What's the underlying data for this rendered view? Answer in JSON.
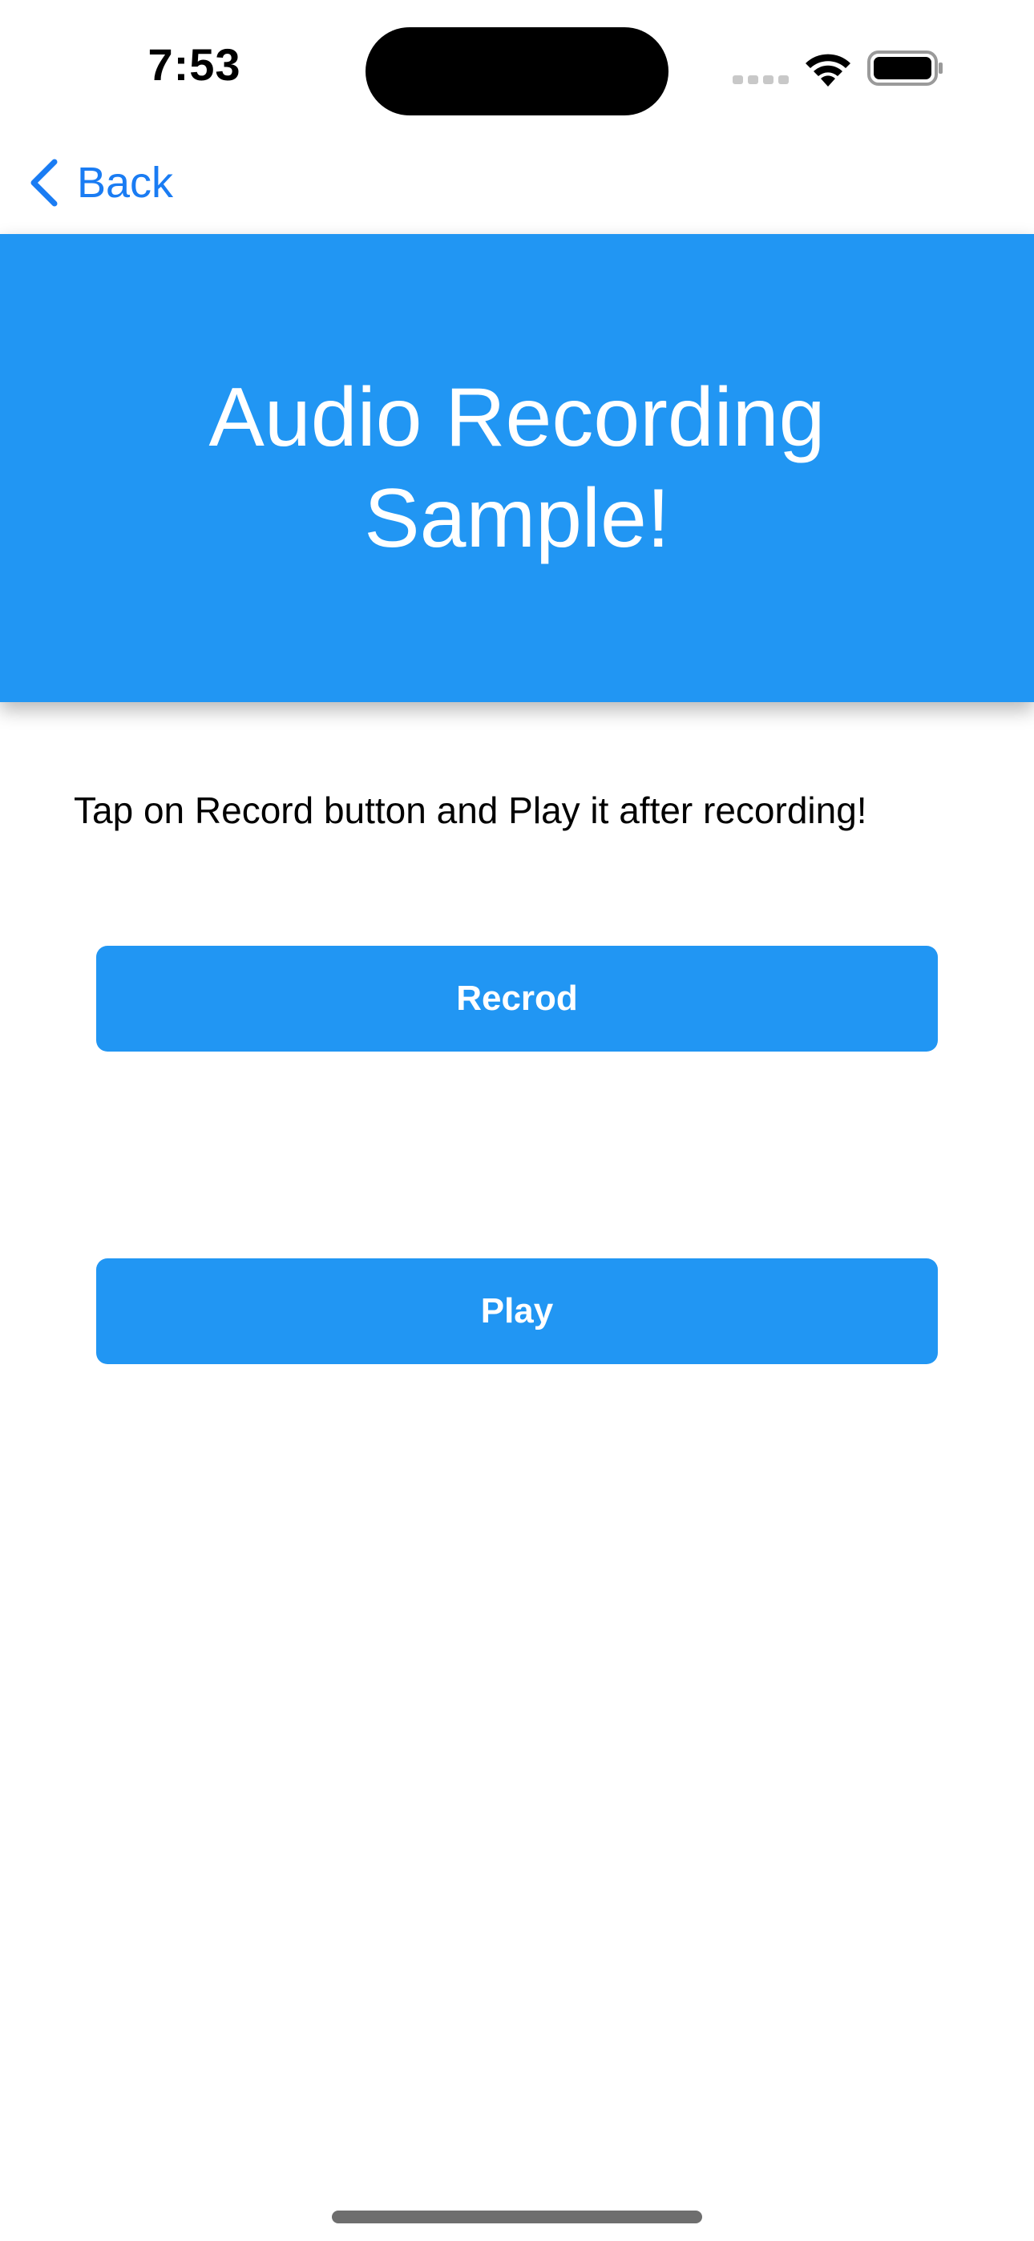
{
  "status_bar": {
    "time": "7:53",
    "icons": [
      "signal-icon",
      "wifi-icon",
      "battery-icon"
    ]
  },
  "nav": {
    "back_label": "Back",
    "back_icon": "chevron-left-icon"
  },
  "header": {
    "title": "Audio Recording Sample!"
  },
  "main": {
    "instruction": "Tap on Record button and Play it after recording!",
    "record_label": "Recrod",
    "play_label": "Play"
  },
  "colors": {
    "accent": "#2196f3",
    "link": "#1a7cf3",
    "background": "#ffffff",
    "text": "#000000"
  }
}
